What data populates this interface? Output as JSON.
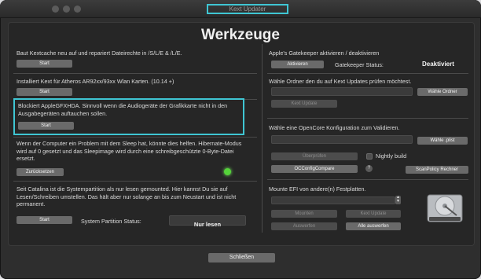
{
  "window": {
    "title": "Kext Updater"
  },
  "heading": "Werkzeuge",
  "left": {
    "kextcache": {
      "desc": "Baut Kextcache neu auf und repariert Dateirechte in /S/L/E & /L/E.",
      "button": "Start"
    },
    "atheros": {
      "desc": "Installiert Kext für Atheros AR92xx/93xx Wlan Karten. (10.14 +)",
      "button": "Start"
    },
    "hda": {
      "desc": "Blockiert AppleGFXHDA. Sinnvoll wenn die Audiogeräte der Grafikkarte nicht in den Ausgabegeräten auftauchen sollen.",
      "button": "Start"
    },
    "sleep": {
      "desc": "Wenn der Computer ein Problem mit dem Sleep hat, könnte dies helfen. Hibernate-Modus wird auf 0 gesetzt und das Sleepimage wird durch eine schreibgeschützte 0-Byte-Datei ersetzt.",
      "button": "Zurücksetzen"
    },
    "partition": {
      "desc": "Seit Catalina ist die Systempartition als nur lesen gemounted. Hier kannst Du sie auf Lesen/Schreiben umstellen. Das hält aber nur solange an bis zum Neustart und ist nicht permanent.",
      "button": "Start",
      "status_label": "System Partition Status:",
      "status_value": "Nur lesen"
    }
  },
  "right": {
    "gatekeeper": {
      "title": "Apple's Gatekeeper aktivieren / deaktivieren",
      "button": "Aktivieren",
      "status_label": "Gatekeeper Status:",
      "status_value": "Deaktiviert"
    },
    "folder": {
      "title": "Wähle Ordner den du auf Kext Updates prüfen möchtest.",
      "choose_button": "Wähle Ordner",
      "check_button": "Kext Update"
    },
    "opencore": {
      "title": "Wähle eine OpenCore Konfiguration zum Validieren.",
      "choose_button": "Wähle .plist",
      "validate_button": "Überprüfen",
      "nightly_label": "Nightly build",
      "compare_button": "OCConfigCompare",
      "help": "?",
      "scan_button": "ScanPolicy Rechner"
    },
    "efi": {
      "title": "Mounte EFI von andere(n) Festplatten.",
      "mount_button": "Mounten",
      "unmount_button": "Auswerfen",
      "check_button": "Kext Update",
      "eject_all_button": "Alle auswerfen"
    }
  },
  "footer": {
    "close_button": "Schließen"
  },
  "colors": {
    "highlight": "#3fc6d3",
    "indicator": "#55d43a"
  }
}
